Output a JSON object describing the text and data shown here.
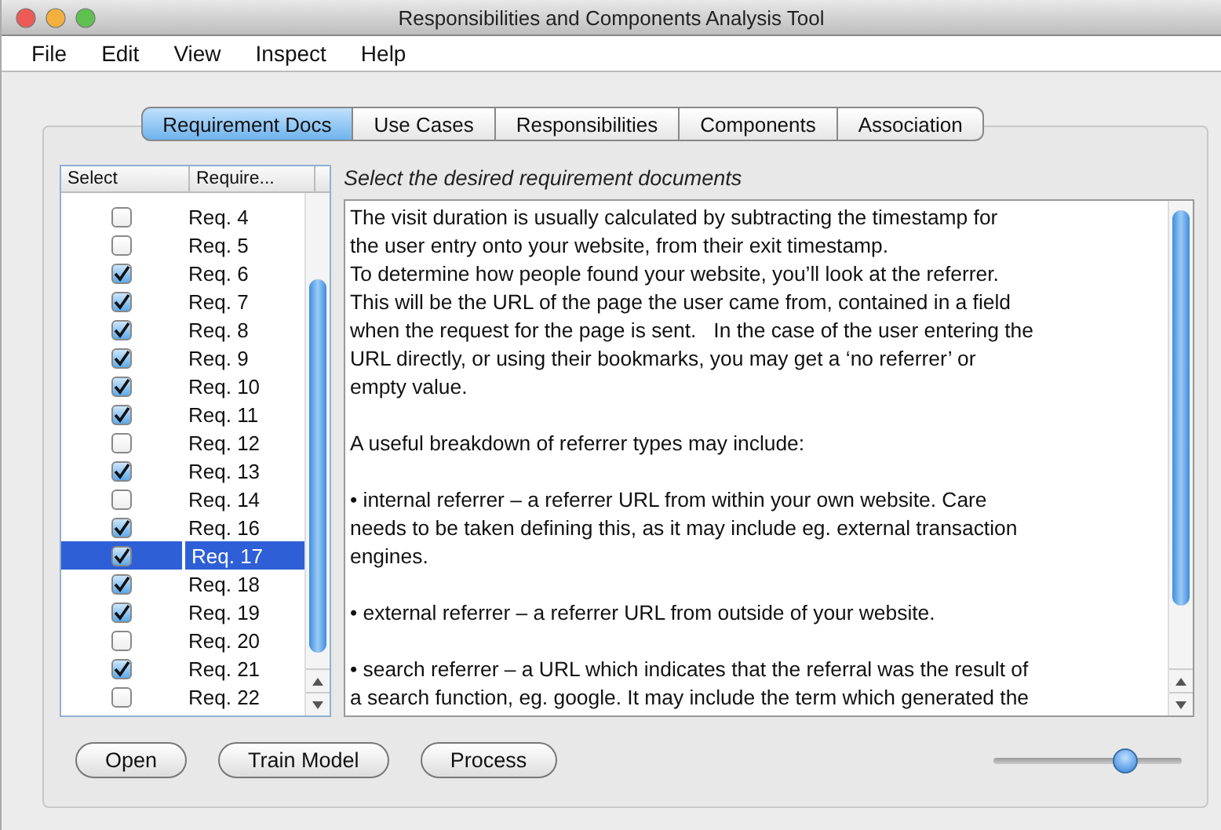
{
  "window": {
    "title": "Responsibilities and Components Analysis Tool"
  },
  "menu": [
    "File",
    "Edit",
    "View",
    "Inspect",
    "Help"
  ],
  "tabs": [
    {
      "label": "Requirement Docs",
      "selected": true
    },
    {
      "label": "Use Cases",
      "selected": false
    },
    {
      "label": "Responsibilities",
      "selected": false
    },
    {
      "label": "Components",
      "selected": false
    },
    {
      "label": "Association",
      "selected": false
    }
  ],
  "table": {
    "columns": [
      "Select",
      "Require..."
    ],
    "rows": [
      {
        "label": "Req. 4",
        "checked": false,
        "selected": false
      },
      {
        "label": "Req. 5",
        "checked": false,
        "selected": false
      },
      {
        "label": "Req. 6",
        "checked": true,
        "selected": false
      },
      {
        "label": "Req. 7",
        "checked": true,
        "selected": false
      },
      {
        "label": "Req. 8",
        "checked": true,
        "selected": false
      },
      {
        "label": "Req. 9",
        "checked": true,
        "selected": false
      },
      {
        "label": "Req. 10",
        "checked": true,
        "selected": false
      },
      {
        "label": "Req. 11",
        "checked": true,
        "selected": false
      },
      {
        "label": "Req. 12",
        "checked": false,
        "selected": false
      },
      {
        "label": "Req. 13",
        "checked": true,
        "selected": false
      },
      {
        "label": "Req. 14",
        "checked": false,
        "selected": false
      },
      {
        "label": "Req. 16",
        "checked": true,
        "selected": false
      },
      {
        "label": "Req. 17",
        "checked": true,
        "selected": true
      },
      {
        "label": "Req. 18",
        "checked": true,
        "selected": false
      },
      {
        "label": "Req. 19",
        "checked": true,
        "selected": false
      },
      {
        "label": "Req. 20",
        "checked": false,
        "selected": false
      },
      {
        "label": "Req. 21",
        "checked": true,
        "selected": false
      },
      {
        "label": "Req. 22",
        "checked": false,
        "selected": false
      }
    ]
  },
  "document": {
    "heading": "Select the desired requirement documents",
    "paragraphs": [
      "The visit duration is usually calculated by subtracting the timestamp for\nthe user entry onto your website, from their exit timestamp.\nTo determine how people found your website, you’ll look at the referrer.\nThis will be the URL of the page the user came from, contained in a field\nwhen the request for the page is sent.   In the case of the user entering the\nURL directly, or using their bookmarks, you may get a ‘no referrer’ or\nempty value.",
      "A useful breakdown of referrer types may include:",
      "• internal referrer – a referrer URL from within your own website. Care\nneeds to be taken defining this, as it may include eg. external transaction\nengines.",
      "• external referrer – a referrer URL from outside of your website.",
      "• search referrer – a URL which indicates that the referral was the result of\na search function, eg. google. It may include the term which generated the"
    ]
  },
  "buttons": [
    "Open",
    "Train Model",
    "Process"
  ],
  "slider": {
    "level": 0.7
  }
}
